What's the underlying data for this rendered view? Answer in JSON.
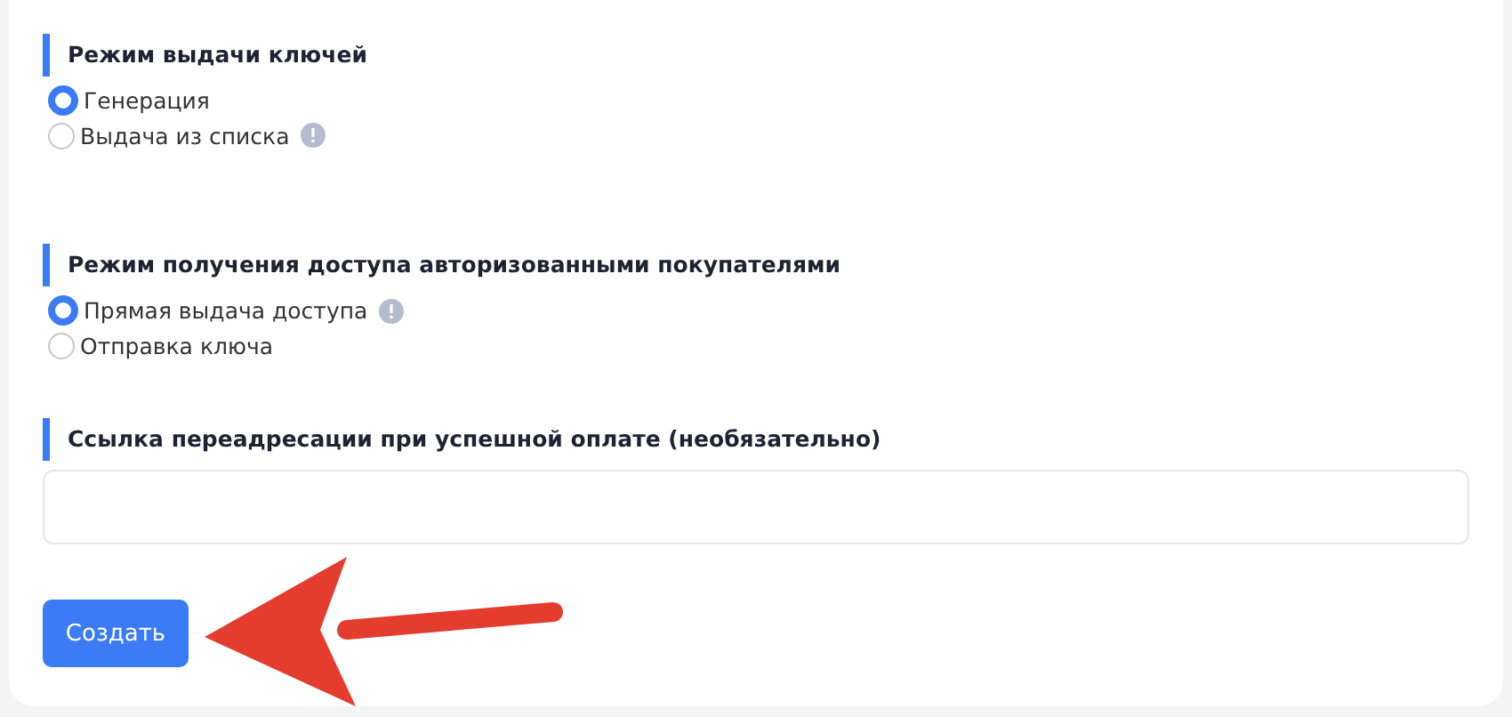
{
  "sections": [
    {
      "title": "Режим выдачи ключей",
      "kind": "radio",
      "options": [
        {
          "label": "Генерация",
          "selected": true,
          "info": false
        },
        {
          "label": "Выдача из списка",
          "selected": false,
          "info": true
        }
      ]
    },
    {
      "title": "Режим получения доступа авторизованными покупателями",
      "kind": "radio",
      "options": [
        {
          "label": "Прямая выдача доступа",
          "selected": true,
          "info": true
        },
        {
          "label": "Отправка ключа",
          "selected": false,
          "info": false
        }
      ]
    },
    {
      "title": "Ссылка переадресации при успешной оплате (необязательно)",
      "kind": "input"
    }
  ],
  "submit": {
    "label": "Создать"
  }
}
